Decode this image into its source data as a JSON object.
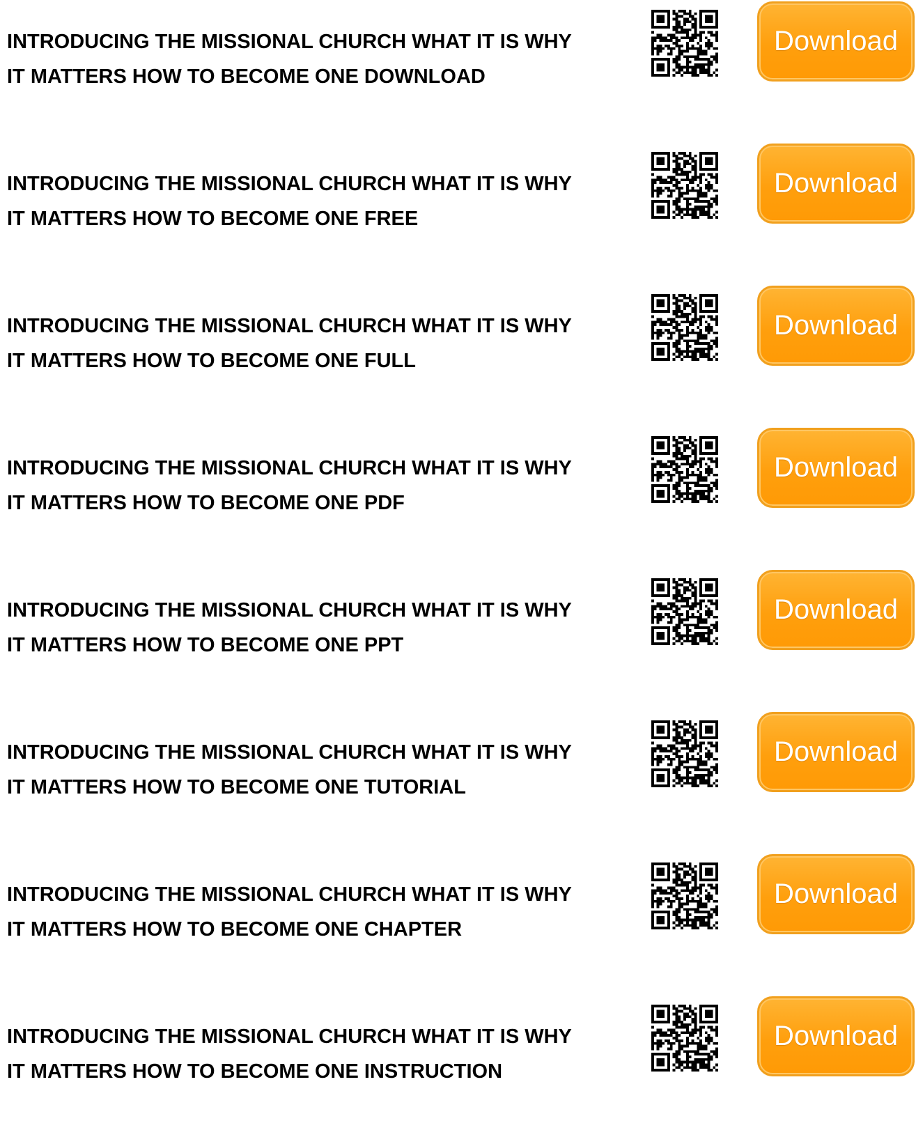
{
  "download_label": "Download",
  "accent_color": "#ff9f0d",
  "items": [
    {
      "line1": "INTRODUCING THE MISSIONAL CHURCH WHAT IT IS WHY",
      "line2": "IT MATTERS HOW TO BECOME ONE DOWNLOAD",
      "icon": "qr-code-icon"
    },
    {
      "line1": "INTRODUCING THE MISSIONAL CHURCH WHAT IT IS WHY",
      "line2": "IT MATTERS HOW TO BECOME ONE FREE",
      "icon": "qr-code-icon"
    },
    {
      "line1": "INTRODUCING THE MISSIONAL CHURCH WHAT IT IS WHY",
      "line2": "IT MATTERS HOW TO BECOME ONE FULL",
      "icon": "qr-code-icon"
    },
    {
      "line1": "INTRODUCING THE MISSIONAL CHURCH WHAT IT IS WHY",
      "line2": "IT MATTERS HOW TO BECOME ONE PDF",
      "icon": "qr-code-icon"
    },
    {
      "line1": "INTRODUCING THE MISSIONAL CHURCH WHAT IT IS WHY",
      "line2": "IT MATTERS HOW TO BECOME ONE PPT",
      "icon": "qr-code-icon"
    },
    {
      "line1": "INTRODUCING THE MISSIONAL CHURCH WHAT IT IS WHY",
      "line2": "IT MATTERS HOW TO BECOME ONE TUTORIAL",
      "icon": "qr-code-icon"
    },
    {
      "line1": "INTRODUCING THE MISSIONAL CHURCH WHAT IT IS WHY",
      "line2": "IT MATTERS HOW TO BECOME ONE CHAPTER",
      "icon": "qr-code-icon"
    },
    {
      "line1": "INTRODUCING THE MISSIONAL CHURCH WHAT IT IS WHY",
      "line2": "IT MATTERS HOW TO BECOME ONE INSTRUCTION",
      "icon": "qr-code-icon"
    }
  ]
}
